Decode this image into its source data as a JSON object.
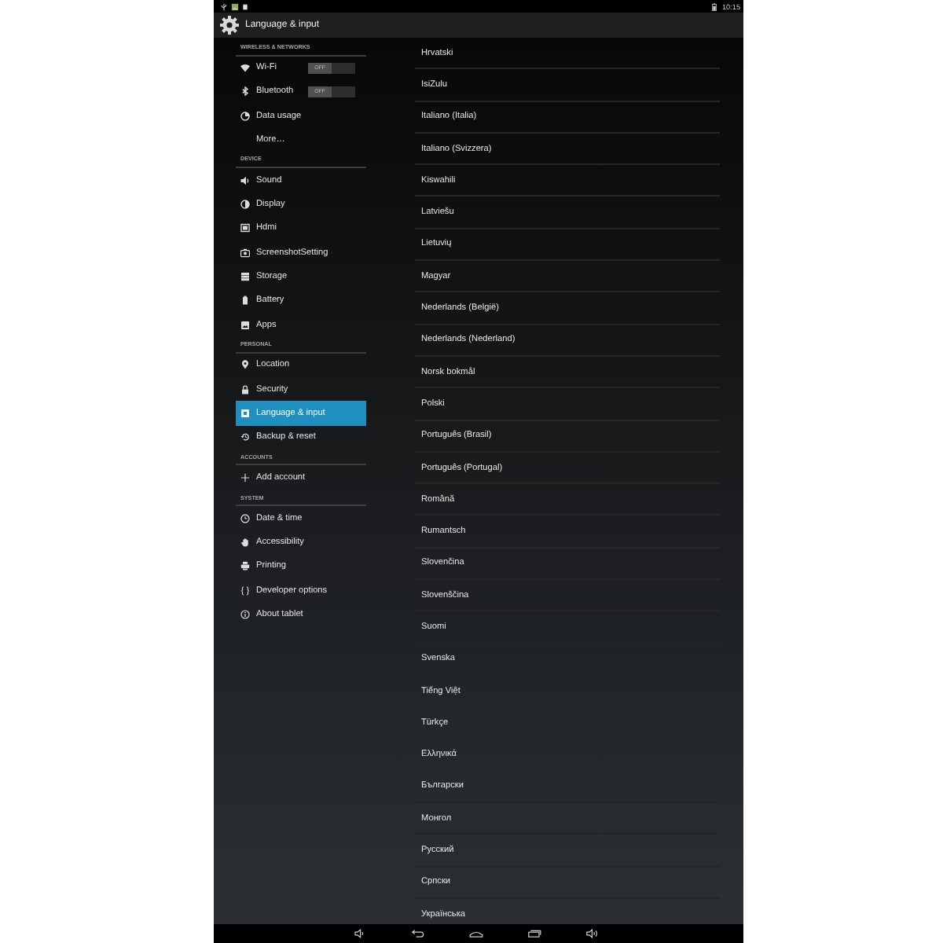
{
  "status_bar": {
    "time": "10:15"
  },
  "action_bar": {
    "title": "Language & input"
  },
  "sidebar": {
    "sections": [
      {
        "header": "WIRELESS & NETWORKS",
        "items": [
          {
            "label": "Wi-Fi",
            "kind": "switch",
            "switch_label": "OFF",
            "on": false,
            "selected": false
          },
          {
            "label": "Bluetooth",
            "kind": "switch",
            "switch_label": "OFF",
            "on": false,
            "selected": false
          },
          {
            "label": "Data usage",
            "kind": "link",
            "selected": false
          },
          {
            "label": "More…",
            "kind": "link",
            "selected": false
          }
        ]
      },
      {
        "header": "DEVICE",
        "items": [
          {
            "label": "Sound",
            "kind": "link",
            "selected": false
          },
          {
            "label": "Display",
            "kind": "link",
            "selected": false
          },
          {
            "label": "Hdmi",
            "kind": "link",
            "selected": false
          },
          {
            "label": "ScreenshotSetting",
            "kind": "link",
            "selected": false
          },
          {
            "label": "Storage",
            "kind": "link",
            "selected": false
          },
          {
            "label": "Battery",
            "kind": "link",
            "selected": false
          },
          {
            "label": "Apps",
            "kind": "link",
            "selected": false
          }
        ]
      },
      {
        "header": "PERSONAL",
        "items": [
          {
            "label": "Location",
            "kind": "link",
            "selected": false
          },
          {
            "label": "Security",
            "kind": "link",
            "selected": false
          },
          {
            "label": "Language & input",
            "kind": "link",
            "selected": true
          },
          {
            "label": "Backup & reset",
            "kind": "link",
            "selected": false
          }
        ]
      },
      {
        "header": "ACCOUNTS",
        "items": [
          {
            "label": "Add account",
            "kind": "link",
            "selected": false
          }
        ]
      },
      {
        "header": "SYSTEM",
        "items": [
          {
            "label": "Date & time",
            "kind": "link",
            "selected": false
          },
          {
            "label": "Accessibility",
            "kind": "link",
            "selected": false
          },
          {
            "label": "Printing",
            "kind": "link",
            "selected": false
          },
          {
            "label": "Developer options",
            "kind": "link",
            "selected": false
          },
          {
            "label": "About tablet",
            "kind": "link",
            "selected": false
          }
        ]
      }
    ]
  },
  "languages": [
    "Hrvatski",
    "IsiZulu",
    "Italiano (Italia)",
    "Italiano (Svizzera)",
    "Kiswahili",
    "Latviešu",
    "Lietuvių",
    "Magyar",
    "Nederlands (België)",
    "Nederlands (Nederland)",
    "Norsk bokmål",
    "Polski",
    "Português (Brasil)",
    "Português (Portugal)",
    "Română",
    "Rumantsch",
    "Slovenčina",
    "Slovenščina",
    "Suomi",
    "Svenska",
    "Tiếng Việt",
    "Türkçe",
    "Ελληνικά",
    "Български",
    "Монгол",
    "Русский",
    "Српски",
    "Українська"
  ]
}
